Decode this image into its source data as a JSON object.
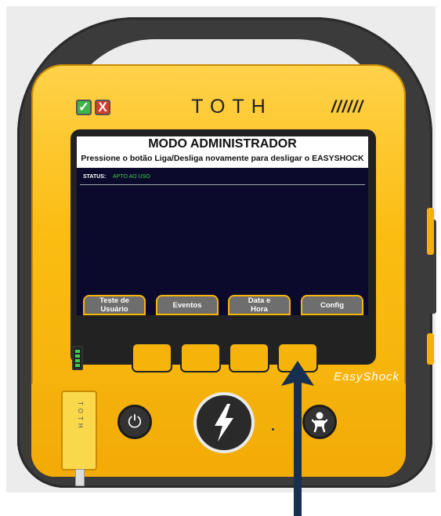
{
  "device": {
    "brand": "TOTH",
    "model_label": "EasyShock",
    "decoration": "//////",
    "indicators": {
      "ok_symbol": "✓",
      "error_symbol": "X"
    },
    "connector_text": "TOTH"
  },
  "screen": {
    "title": "MODO ADMINISTRADOR",
    "subtitle": "Pressione o botão Liga/Desliga novamente para desligar o EASYSHOCK",
    "status_label": "STATUS:",
    "status_value": "APTO AO USO"
  },
  "softkeys": [
    {
      "label": "Teste de\nUsuário"
    },
    {
      "label": "Eventos"
    },
    {
      "label": "Data e\nHora"
    },
    {
      "label": "Config"
    }
  ],
  "icons": {
    "power": "power-icon",
    "shock": "lightning-icon",
    "pediatric": "child-icon",
    "battery": "battery-icon",
    "annotation": "arrow-up-icon"
  },
  "colors": {
    "body": "#fbbd13",
    "screen_bg": "#0b0a2c",
    "status_ok": "#3fcf4a",
    "arrow": "#17304f",
    "softkey_bg": "#6e6e6e"
  },
  "battery_level": 1.0
}
